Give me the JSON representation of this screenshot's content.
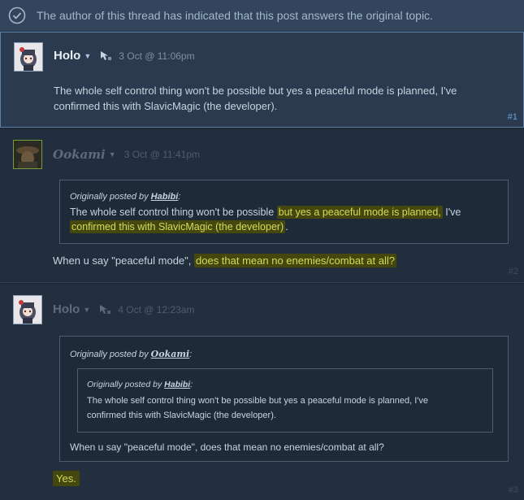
{
  "answer_banner": {
    "text": "The author of this thread has indicated that this post answers the original topic."
  },
  "posts": [
    {
      "author": "Holo",
      "date": "3 Oct @ 11:06pm",
      "body": "The whole self control thing won't be possible but yes a peaceful mode is planned, I've confirmed this with SlavicMagic (the developer).",
      "body_line1": "The whole self control thing won't be possible but yes a peaceful mode is planned, I've",
      "body_line2": "confirmed this with SlavicMagic (the developer).",
      "number": "#1"
    },
    {
      "author": "Ookami",
      "date": "3 Oct @ 11:41pm",
      "quote": {
        "prefix": "Originally posted by ",
        "author": "Habibi",
        "suffix": ":",
        "line1_plain": "The whole self control thing won't be possible ",
        "line1_hl": "but yes a peaceful mode is planned,",
        "line1_end": " I've",
        "line2_hl": "confirmed this with SlavicMagic (the developer)",
        "line2_end": "."
      },
      "body_plain": "When u say \"peaceful mode\", ",
      "body_hl": "does that mean no enemies/combat at all?",
      "number": "#2"
    },
    {
      "author": "Holo",
      "date": "4 Oct @ 12:23am",
      "quote": {
        "prefix": "Originally posted by ",
        "author": "Ookami",
        "suffix": ":",
        "inner": {
          "prefix": "Originally posted by ",
          "author": "Habibi",
          "suffix": ":",
          "line1": "The whole self control thing won't be possible but yes a peaceful mode is planned, I've",
          "line2": "confirmed this with SlavicMagic (the developer)."
        },
        "text": "When u say \"peaceful mode\", does that mean no enemies/combat at all?"
      },
      "body": "Yes.",
      "number": "#3"
    }
  ]
}
